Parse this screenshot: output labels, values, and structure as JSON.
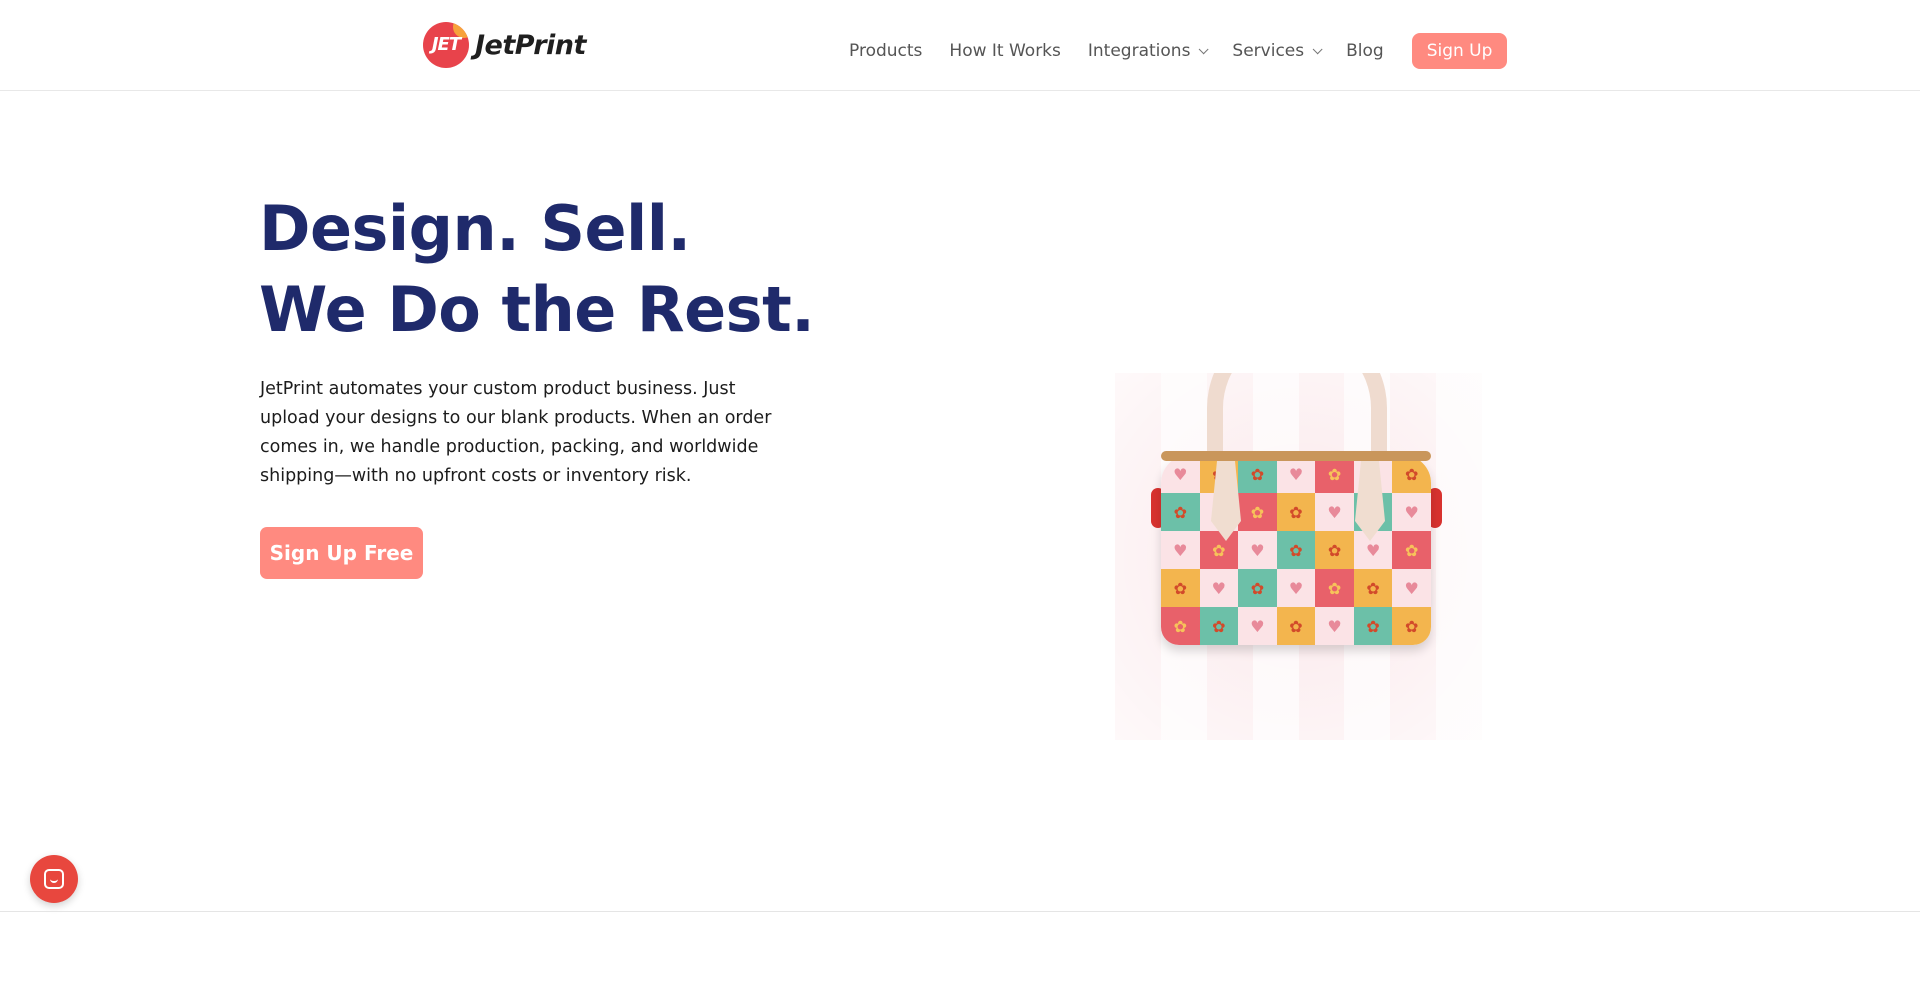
{
  "brand": {
    "logo_mark_text": "JET",
    "name": "JetPrint",
    "accent_color": "#ff8a80",
    "title_color": "#1f2a6b"
  },
  "nav": {
    "items": [
      {
        "label": "Products",
        "has_dropdown": false
      },
      {
        "label": "How It Works",
        "has_dropdown": false
      },
      {
        "label": "Integrations",
        "has_dropdown": true
      },
      {
        "label": "Services",
        "has_dropdown": true
      },
      {
        "label": "Blog",
        "has_dropdown": false
      }
    ],
    "signup_label": "Sign Up"
  },
  "hero": {
    "title_line1": "Design. Sell.",
    "title_line2": "We Do the Rest.",
    "description": "JetPrint automates your custom product business. Just upload your designs to our blank products. When an order comes in, we handle production, packing, and worldwide shipping—with no upfront costs or inventory risk.",
    "cta_label": "Sign Up Free"
  },
  "icons": {
    "chat": "chat-icon",
    "chevron": "chevron-down-icon"
  }
}
